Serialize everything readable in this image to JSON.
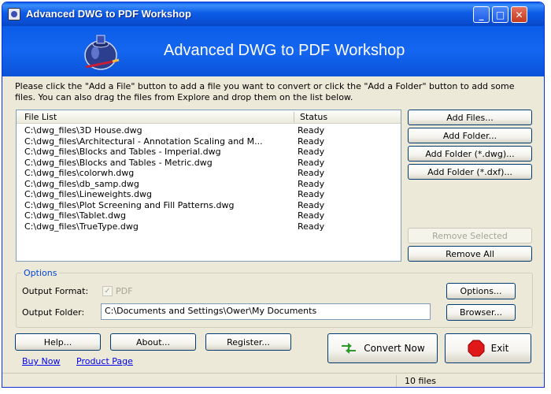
{
  "window": {
    "title": "Advanced DWG to PDF Workshop",
    "minimize_glyph": "_",
    "maximize_glyph": "□",
    "close_glyph": "✕"
  },
  "banner": {
    "title": "Advanced DWG to PDF Workshop"
  },
  "instructions": "Please click the \"Add a File\" button to add a file you want to convert or click the \"Add a Folder\" button to add some files. You can also drag the files from Explore and drop them on the list below.",
  "file_list": {
    "columns": {
      "file": "File List",
      "status": "Status"
    },
    "rows": [
      {
        "name": "C:\\dwg_files\\3D House.dwg",
        "status": "Ready"
      },
      {
        "name": "C:\\dwg_files\\Architectural - Annotation Scaling and M...",
        "status": "Ready"
      },
      {
        "name": "C:\\dwg_files\\Blocks and Tables - Imperial.dwg",
        "status": "Ready"
      },
      {
        "name": "C:\\dwg_files\\Blocks and Tables - Metric.dwg",
        "status": "Ready"
      },
      {
        "name": "C:\\dwg_files\\colorwh.dwg",
        "status": "Ready"
      },
      {
        "name": "C:\\dwg_files\\db_samp.dwg",
        "status": "Ready"
      },
      {
        "name": "C:\\dwg_files\\Lineweights.dwg",
        "status": "Ready"
      },
      {
        "name": "C:\\dwg_files\\Plot Screening and Fill Patterns.dwg",
        "status": "Ready"
      },
      {
        "name": "C:\\dwg_files\\Tablet.dwg",
        "status": "Ready"
      },
      {
        "name": "C:\\dwg_files\\TrueType.dwg",
        "status": "Ready"
      }
    ]
  },
  "side_buttons": {
    "add_files": "Add Files...",
    "add_folder": "Add Folder...",
    "add_folder_dwg": "Add Folder (*.dwg)...",
    "add_folder_dxf": "Add Folder (*.dxf)...",
    "remove_selected": "Remove Selected",
    "remove_all": "Remove All"
  },
  "options": {
    "legend": "Options",
    "output_format_label": "Output Format:",
    "output_format_value": "PDF",
    "output_format_checked": "✓",
    "output_folder_label": "Output Folder:",
    "output_folder_value": "C:\\Documents and Settings\\Ower\\My Documents",
    "options_button": "Options...",
    "browser_button": "Browser..."
  },
  "bottom": {
    "help": "Help...",
    "about": "About...",
    "register": "Register...",
    "convert_now": "Convert Now",
    "exit": "Exit",
    "buy_now": "Buy Now",
    "product_page": "Product Page"
  },
  "status_bar": {
    "file_count": "10 files"
  },
  "colors": {
    "titlebar": "#0a50d6",
    "window_bg": "#ece9d8",
    "link": "#0000ee",
    "legend": "#0046d5"
  }
}
